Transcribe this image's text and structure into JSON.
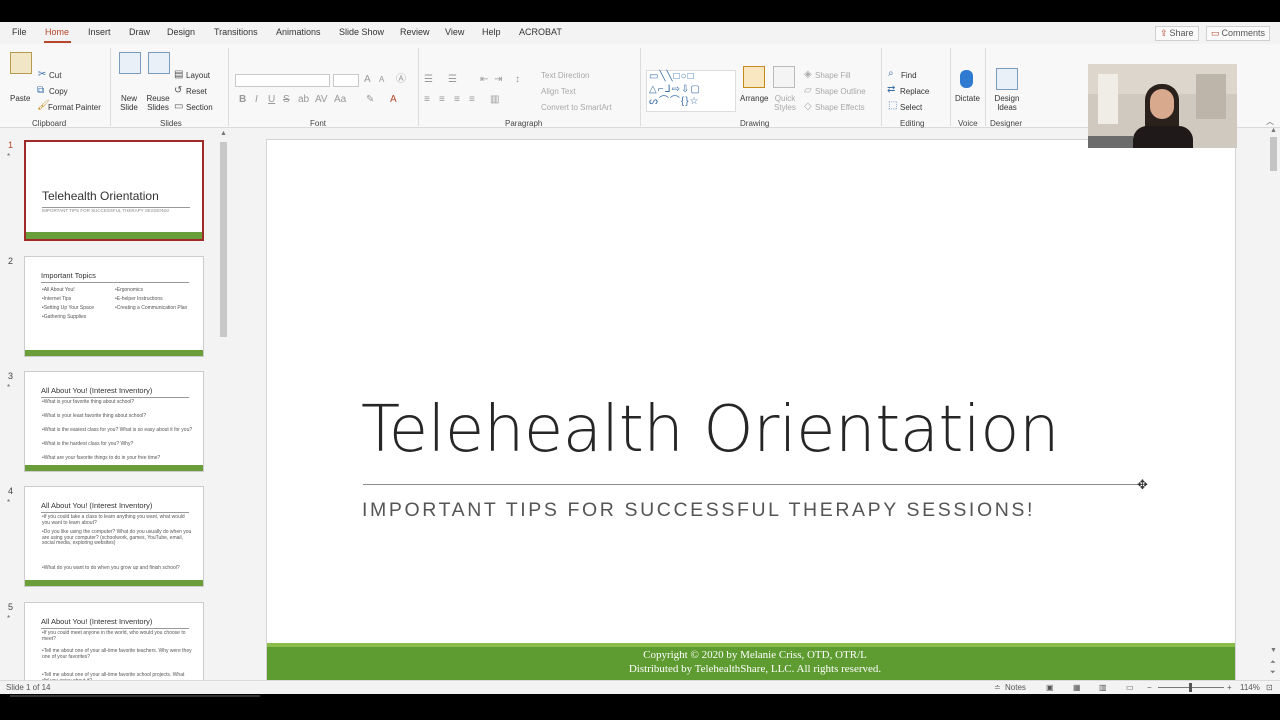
{
  "tabs": [
    "File",
    "Home",
    "Insert",
    "Draw",
    "Design",
    "Transitions",
    "Animations",
    "Slide Show",
    "Review",
    "View",
    "Help",
    "ACROBAT"
  ],
  "share_label": "Share",
  "comments_label": "Comments",
  "ribbon": {
    "clipboard": {
      "paste": "Paste",
      "cut": "Cut",
      "copy": "Copy",
      "format_painter": "Format Painter",
      "label": "Clipboard"
    },
    "slides": {
      "new_slide": "New Slide",
      "reuse_slides": "Reuse Slides",
      "layout": "Layout",
      "reset": "Reset",
      "section": "Section",
      "label": "Slides"
    },
    "font": {
      "label": "Font"
    },
    "paragraph": {
      "text_direction": "Text Direction",
      "align_text": "Align Text",
      "convert_smartart": "Convert to SmartArt",
      "label": "Paragraph"
    },
    "drawing": {
      "arrange": "Arrange",
      "quick_styles": "Quick Styles",
      "shape_fill": "Shape Fill",
      "shape_outline": "Shape Outline",
      "shape_effects": "Shape Effects",
      "label": "Drawing"
    },
    "editing": {
      "find": "Find",
      "replace": "Replace",
      "select": "Select",
      "label": "Editing"
    },
    "voice": {
      "dictate": "Dictate",
      "label": "Voice"
    },
    "designer": {
      "design_ideas": "Design Ideas",
      "label": "Designer"
    }
  },
  "thumbnails": [
    {
      "num": "1",
      "title": "Telehealth Orientation",
      "subtitle": "IMPORTANT TIPS FOR SUCCESSFUL THERAPY SESSIONS!"
    },
    {
      "num": "2",
      "title": "Important Topics",
      "left_items": [
        "•All About You!",
        "•Internet Tips",
        "•Setting Up Your Space",
        "•Gathering Supplies"
      ],
      "right_items": [
        "•Ergonomics",
        "•E-helper Instructions",
        "•Creating a Communication Plan"
      ]
    },
    {
      "num": "3",
      "title": "All About You! (Interest Inventory)",
      "items": [
        "•What is your favorite thing about school?",
        "•What is your least favorite thing about school?",
        "•What is the easiest class for you? What is so easy about it for you?",
        "•What is the hardest class for you? Why?",
        "•What are your favorite things to do in your free time?"
      ]
    },
    {
      "num": "4",
      "title": "All About You! (Interest Inventory)",
      "items": [
        "•If you could take a class to learn anything you want, what would you want to learn about?",
        "•Do you like using the computer? What do you usually do when you are using your computer? (schoolwork, games, YouTube, email, social media, exploring websites)",
        "•What do you want to do when you grow up and finish school?"
      ]
    },
    {
      "num": "5",
      "title": "All About You! (Interest Inventory)",
      "items": [
        "•If you could meet anyone in the world, who would you choose to meet?",
        "•Tell me about one of your all-time favorite teachers. Why were they one of your favorites?",
        "•Tell me about one of your all-time favorite school projects. What did you enjoy about it?"
      ]
    }
  ],
  "slide": {
    "title": "Telehealth Orientation",
    "subtitle": "IMPORTANT TIPS FOR SUCCESSFUL THERAPY SESSIONS!",
    "copyright_line1": "Copyright © 2020 by Melanie Criss, OTD, OTR/L",
    "copyright_line2": "Distributed by TelehealthShare, LLC.  All rights reserved."
  },
  "status": {
    "slide_info": "Slide 1 of 14",
    "notes": "Notes",
    "zoom": "114%"
  },
  "colors": {
    "accent": "#b7472a",
    "slide_band": "#5e9b31",
    "thumb_selected_border": "#9e2a2a"
  }
}
